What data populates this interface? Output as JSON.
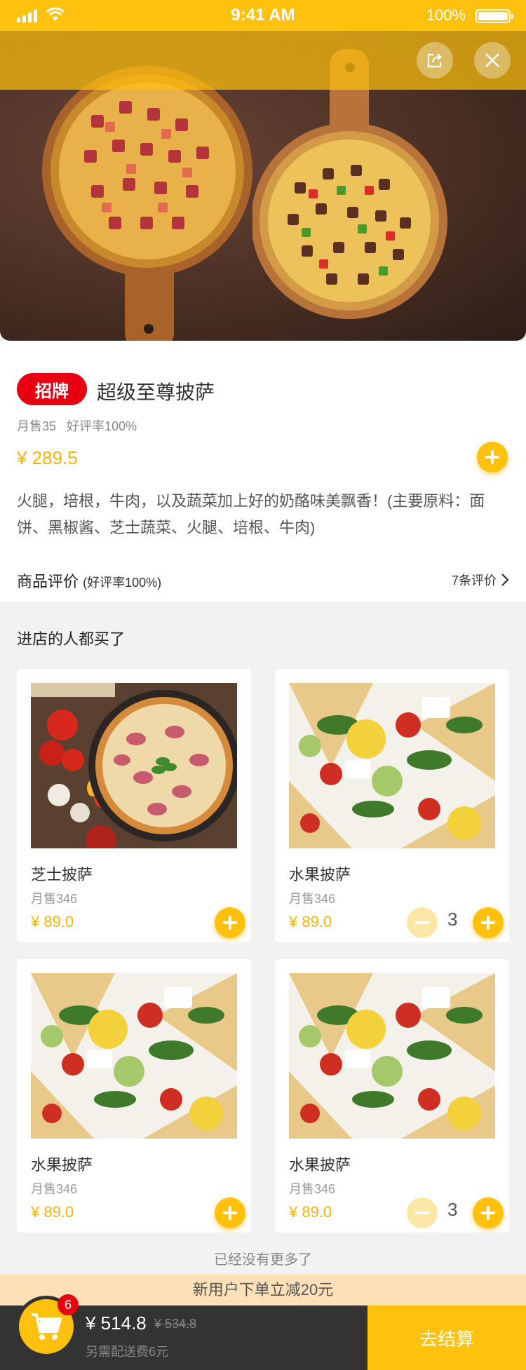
{
  "status_bar": {
    "time": "9:41 AM",
    "battery": "100%"
  },
  "product": {
    "tag": "招牌",
    "name": "超级至尊披萨",
    "sales": "月售35",
    "rating": "好评率100%",
    "price": "¥ 289.5",
    "description": "火腿，培根，牛肉，以及蔬菜加上好的奶酪味美飘香！(主要原料：面饼、黑椒酱、芝士蔬菜、火腿、培根、牛肉)"
  },
  "reviews": {
    "label": "商品评价",
    "sub": "(好评率100%)",
    "count": "7条评价"
  },
  "recommend": {
    "title": "进店的人都买了",
    "items": [
      {
        "name": "芝士披萨",
        "sales": "月售346",
        "price": "¥ 89.0",
        "qty": ""
      },
      {
        "name": "水果披萨",
        "sales": "月售346",
        "price": "¥ 89.0",
        "qty": "3"
      },
      {
        "name": "水果披萨",
        "sales": "月售346",
        "price": "¥ 89.0",
        "qty": ""
      },
      {
        "name": "水果披萨",
        "sales": "月售346",
        "price": "¥ 89.0",
        "qty": "3"
      }
    ]
  },
  "no_more": "已经没有更多了",
  "promo": "新用户下单立减20元",
  "cart": {
    "badge": "6",
    "total": "¥ 514.8",
    "original": "¥ 534.8",
    "delivery_fee": "另需配送费6元",
    "checkout": "去结算"
  },
  "colors": {
    "accent": "#fec10e",
    "price": "#fbb204",
    "tag": "#e60012",
    "cart_bar": "#333333"
  }
}
